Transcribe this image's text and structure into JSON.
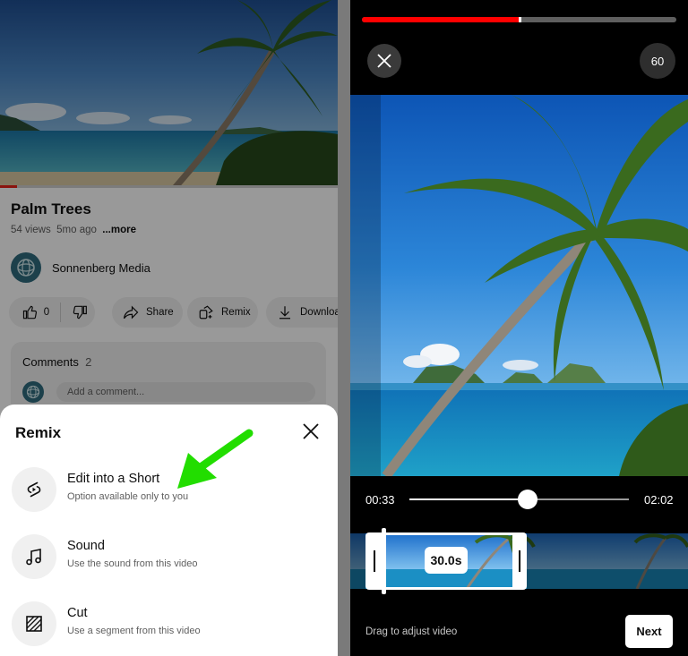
{
  "colors": {
    "accent_red": "#ff0000",
    "arrow_green": "#22dd00",
    "sheet_bg": "#ffffff",
    "editor_bg": "#000000"
  },
  "left_panel": {
    "video": {
      "title": "Palm Trees",
      "views": "54 views",
      "age": "5mo ago",
      "more": "...more",
      "progress_fraction": 0.05
    },
    "channel": {
      "name": "Sonnenberg Media",
      "avatar_icon": "globe-logo-icon"
    },
    "actions": {
      "like_count": "0",
      "share": "Share",
      "remix": "Remix",
      "download": "Download"
    },
    "comments": {
      "label": "Comments",
      "count": "2",
      "placeholder": "Add a comment..."
    },
    "remix_sheet": {
      "title": "Remix",
      "options": [
        {
          "icon": "shorts-icon",
          "title": "Edit into a Short",
          "subtitle": "Option available only to you"
        },
        {
          "icon": "music-note-icon",
          "title": "Sound",
          "subtitle": "Use the sound from this video"
        },
        {
          "icon": "cut-icon",
          "title": "Cut",
          "subtitle": "Use a segment from this video"
        }
      ]
    }
  },
  "right_panel": {
    "top_progress_fraction": 0.5,
    "duration_button": "60",
    "scrubber": {
      "current_time": "00:33",
      "total_time": "02:02",
      "position_fraction": 0.54
    },
    "selection_duration": "30.0s",
    "hint": "Drag to adjust video",
    "next": "Next"
  }
}
